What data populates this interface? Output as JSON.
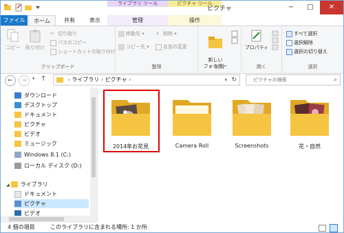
{
  "window": {
    "title": "ピクチャ",
    "context_headers": [
      "ライブラリ ツール",
      "ピクチャ ツール"
    ],
    "minimize": "−",
    "maximize": "□",
    "close": "✕"
  },
  "tabs": [
    "ファイル",
    "ホーム",
    "共有",
    "表示",
    "管理",
    "操作"
  ],
  "ribbon": {
    "clipboard": {
      "label": "クリップボード",
      "copy": "コピー",
      "paste": "貼り付け",
      "cut": "切り取り",
      "copy_path": "パスのコピー",
      "paste_shortcut": "ショートカットの貼り付け"
    },
    "organize": {
      "label": "整理",
      "move_to": "移動先 ▾",
      "copy_to": "コピー先 ▾",
      "delete": "削除 ▾",
      "rename": "名前の変更"
    },
    "new": {
      "label": "新規",
      "new_folder": "新しい\nフォルダー"
    },
    "open": {
      "label": "開く",
      "properties": "プロパティ"
    },
    "select": {
      "label": "選択",
      "select_all": "すべて選択",
      "select_none": "選択解除",
      "invert": "選択の切り替え"
    }
  },
  "nav": {
    "back": "←",
    "forward": "→",
    "up": "↑",
    "address": [
      "ライブラリ",
      "ピクチャ"
    ],
    "search_placeholder": "ピクチャの検索"
  },
  "sidebar": {
    "items_top": [
      {
        "label": "ダウンロード",
        "icon": "download-folder-icon"
      },
      {
        "label": "デスクトップ",
        "icon": "desktop-folder-icon"
      },
      {
        "label": "ドキュメント",
        "icon": "documents-folder-icon"
      },
      {
        "label": "ピクチャ",
        "icon": "pictures-folder-icon"
      },
      {
        "label": "ビデオ",
        "icon": "videos-folder-icon"
      },
      {
        "label": "ミュージック",
        "icon": "music-folder-icon"
      },
      {
        "label": "Windows 8.1 (C:)",
        "icon": "drive-c-icon"
      },
      {
        "label": "ローカル ディスク (D:)",
        "icon": "drive-d-icon"
      }
    ],
    "libraries": "ライブラリ",
    "library_items": [
      {
        "label": "ドキュメント"
      },
      {
        "label": "ピクチャ"
      },
      {
        "label": "ビデオ"
      }
    ]
  },
  "folders": [
    {
      "name": "2014年お花見",
      "icon": "photo-folder-icon"
    },
    {
      "name": "Camera Roll",
      "icon": "folder-icon"
    },
    {
      "name": "Screenshots",
      "icon": "documents-folder-icon"
    },
    {
      "name": "花・自然",
      "icon": "photo-folder-icon"
    }
  ],
  "status": {
    "count": "4 個の項目",
    "location": "このライブラリに含まれる場所: 1 か所"
  },
  "colors": {
    "accent": "#1979ca",
    "folder": "#f5c542",
    "folder_dark": "#e0a825",
    "selection_outline": "#e00000",
    "library_tools": "#e6d7f5",
    "picture_tools": "#f7ec9b"
  }
}
